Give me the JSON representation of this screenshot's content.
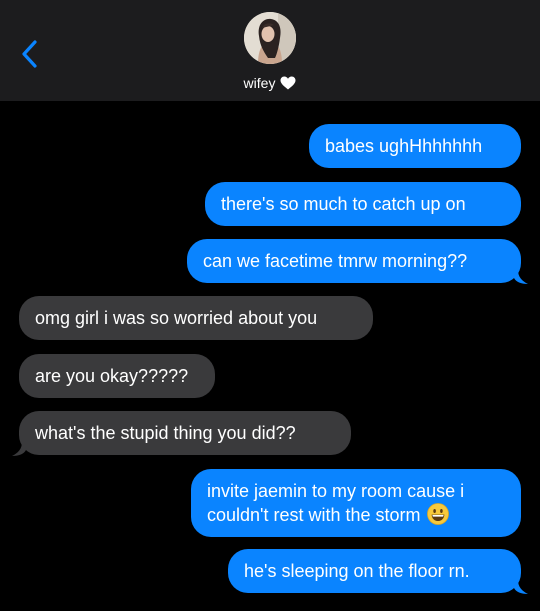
{
  "header": {
    "back_icon": "chevron-left-icon",
    "contact_name": "wifey",
    "contact_heart_icon": "white-heart-icon",
    "avatar": "contact-photo-avatar"
  },
  "colors": {
    "header_bg": "#1c1c1e",
    "background": "#000000",
    "sent_bubble": "#0a84ff",
    "received_bubble": "#3a3a3c",
    "back_chevron": "#0a84ff",
    "text": "#ffffff"
  },
  "messages": [
    {
      "direction": "sent",
      "text": "babes ughHhhhhhh"
    },
    {
      "direction": "sent",
      "text": "there's so much to catch up on"
    },
    {
      "direction": "sent",
      "text": "can we facetime tmrw morning??"
    },
    {
      "direction": "received",
      "text": "omg girl i was so worried about you"
    },
    {
      "direction": "received",
      "text": "are you okay?????"
    },
    {
      "direction": "received",
      "text": "what's the stupid thing you did??"
    },
    {
      "direction": "sent",
      "line1": "invite jaemin to my room cause i",
      "line2": "couldn't rest with the storm",
      "emoji": "grinning-face-emoji"
    },
    {
      "direction": "sent",
      "text": "he's sleeping on the floor rn."
    }
  ]
}
